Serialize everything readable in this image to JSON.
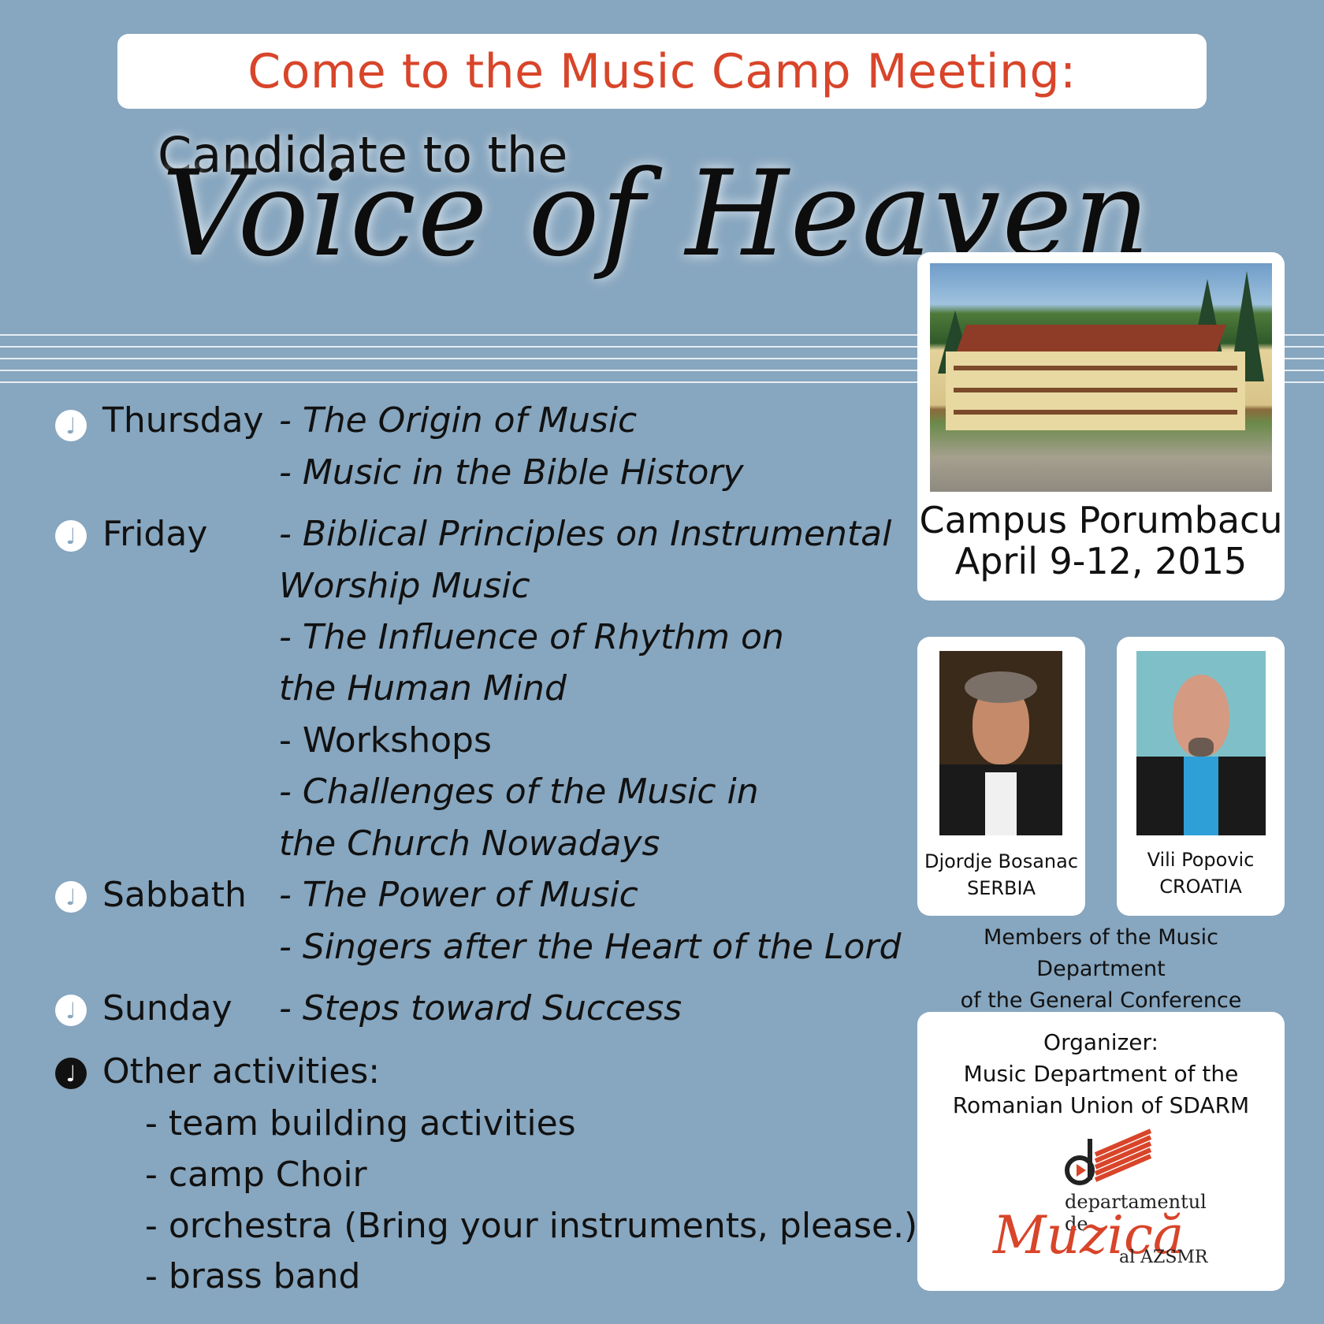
{
  "header": {
    "banner": "Come to the Music Camp Meeting:",
    "subtitle": "Candidate to the",
    "title": "Voice of Heaven"
  },
  "schedule": [
    {
      "day": "Thursday",
      "talks": [
        "- The Origin of Music",
        "- Music in the Bible History"
      ]
    },
    {
      "day": "Friday",
      "talks": [
        "- Biblical Principles on Instrumental",
        "Worship Music",
        "- The Influence of Rhythm on",
        "the Human Mind",
        "- Workshops",
        "- Challenges of the Music in",
        "the Church Nowadays"
      ]
    },
    {
      "day": "Sabbath",
      "talks": [
        "- The Power of Music",
        "- Singers after the Heart of the Lord"
      ]
    },
    {
      "day": "Sunday",
      "talks": [
        "- Steps toward Success"
      ]
    }
  ],
  "other": {
    "title": "Other activities:",
    "items": [
      "- team building activities",
      "- camp Choir",
      "- orchestra (Bring your instruments, please.)",
      "- brass band"
    ]
  },
  "venue": {
    "name": "Campus Porumbacu",
    "dates": "April 9-12, 2015"
  },
  "speakers": [
    {
      "name": "Djordje Bosanac",
      "country": "SERBIA"
    },
    {
      "name": "Vili Popovic",
      "country": "CROATIA"
    }
  ],
  "members_note": [
    "Members of the Music Department",
    "of the General Conference"
  ],
  "organizer": {
    "label": "Organizer:",
    "line1": "Music Department of the",
    "line2": "Romanian Union of  SDARM",
    "logo_dept": "departamentul de",
    "logo_muz": "Muzică",
    "logo_al": "al AZSMR"
  },
  "colors": {
    "background": "#87a6bf",
    "accent": "#d8452a"
  },
  "icons": {
    "bullet": "music-note-icon"
  }
}
